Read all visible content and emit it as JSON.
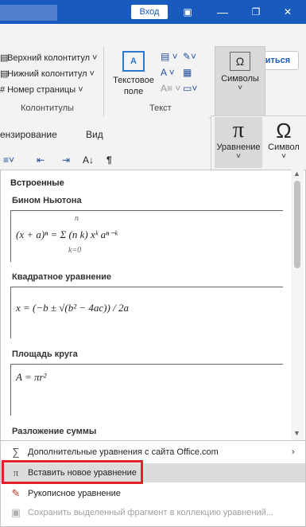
{
  "titlebar": {
    "login_label": "Вход",
    "restore_icon": "❐",
    "close_icon": "✕",
    "min_icon": "▣"
  },
  "ribbon": {
    "share_label": "Поделиться",
    "header_footer": {
      "items": [
        "Верхний колонтитул ˅",
        "Нижний колонтитул ˅",
        "Номер страницы ˅"
      ],
      "group_label": "Колонтитулы"
    },
    "text_group": {
      "textbox_label": "Текстовое\nполе",
      "group_label": "Текст"
    },
    "symbols_label": "Символы"
  },
  "doc_strip": {
    "tab1": "ензирование",
    "tab2": "Вид"
  },
  "sub_panel": {
    "equation_label": "Уравнение",
    "symbol_label": "Символ"
  },
  "gallery": {
    "heading": "Встроенные",
    "equations": [
      {
        "title": "Бином Ньютона",
        "formula": "(x + a)ⁿ = Σ (n k) xᵏ aⁿ⁻ᵏ",
        "sum_top": "n",
        "sum_bottom": "k=0"
      },
      {
        "title": "Квадратное уравнение",
        "formula": "x = (−b ± √(b² − 4ac)) / 2a"
      },
      {
        "title": "Площадь круга",
        "formula": "A = πr²"
      },
      {
        "title": "Разложение суммы"
      }
    ]
  },
  "menu": {
    "items": [
      {
        "label": "Дополнительные уравнения с сайта Office.com",
        "icon": "∑",
        "has_arrow": true
      },
      {
        "label": "Вставить новое уравнение",
        "icon": "π"
      },
      {
        "label": "Рукописное уравнение",
        "icon": "✎"
      },
      {
        "label": "Сохранить выделенный фрагмент в коллекцию уравнений...",
        "icon": "▣"
      }
    ]
  }
}
